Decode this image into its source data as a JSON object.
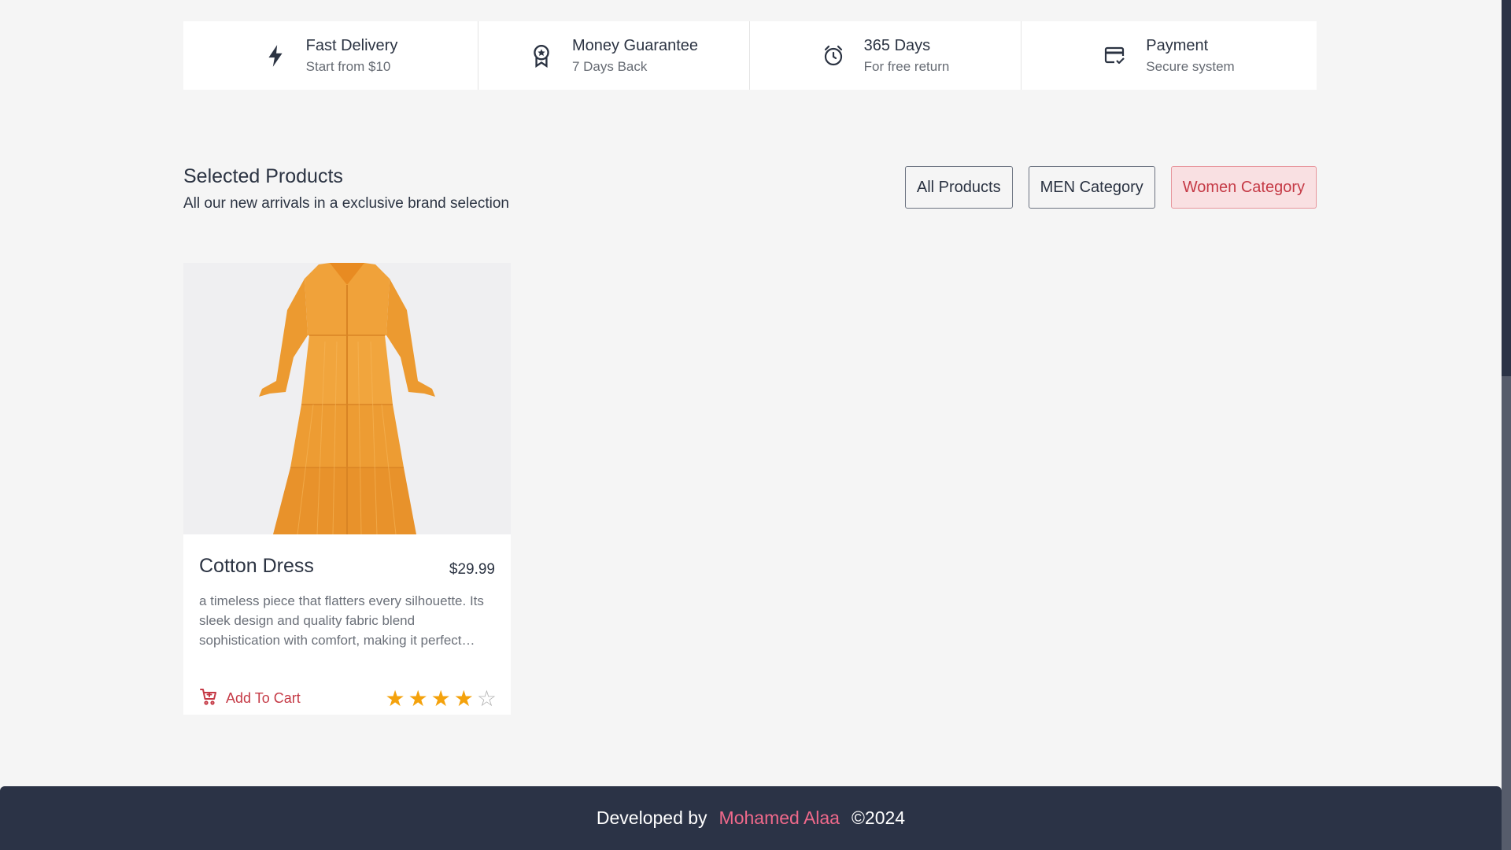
{
  "features": [
    {
      "icon": "lightning-icon",
      "title": "Fast Delivery",
      "subtitle": "Start from $10"
    },
    {
      "icon": "award-badge-icon",
      "title": "Money Guarantee",
      "subtitle": "7 Days Back"
    },
    {
      "icon": "alarm-clock-icon",
      "title": "365 Days",
      "subtitle": "For free return"
    },
    {
      "icon": "credit-card-check-icon",
      "title": "Payment",
      "subtitle": "Secure system"
    }
  ],
  "section": {
    "title": "Selected Products",
    "subtitle": "All our new arrivals in a exclusive brand selection"
  },
  "filters": [
    {
      "label": "All Products",
      "active": false
    },
    {
      "label": "MEN Category",
      "active": false
    },
    {
      "label": "Women Category",
      "active": true
    }
  ],
  "product": {
    "name": "Cotton Dress",
    "price": "$29.99",
    "description": "a timeless piece that flatters every silhouette. Its sleek design and quality fabric blend sophistication with comfort, making it perfect…",
    "add_to_cart": "Add To Cart",
    "rating": 4,
    "rating_max": 5,
    "image_color": "#f0a23a"
  },
  "footer": {
    "prefix": "Developed by",
    "author": "Mohamed Alaa",
    "copyright": "©2024"
  },
  "colors": {
    "accent": "#c53a46",
    "footer_bg": "#2b3346",
    "author": "#f0698b",
    "star": "#f4a20c"
  }
}
